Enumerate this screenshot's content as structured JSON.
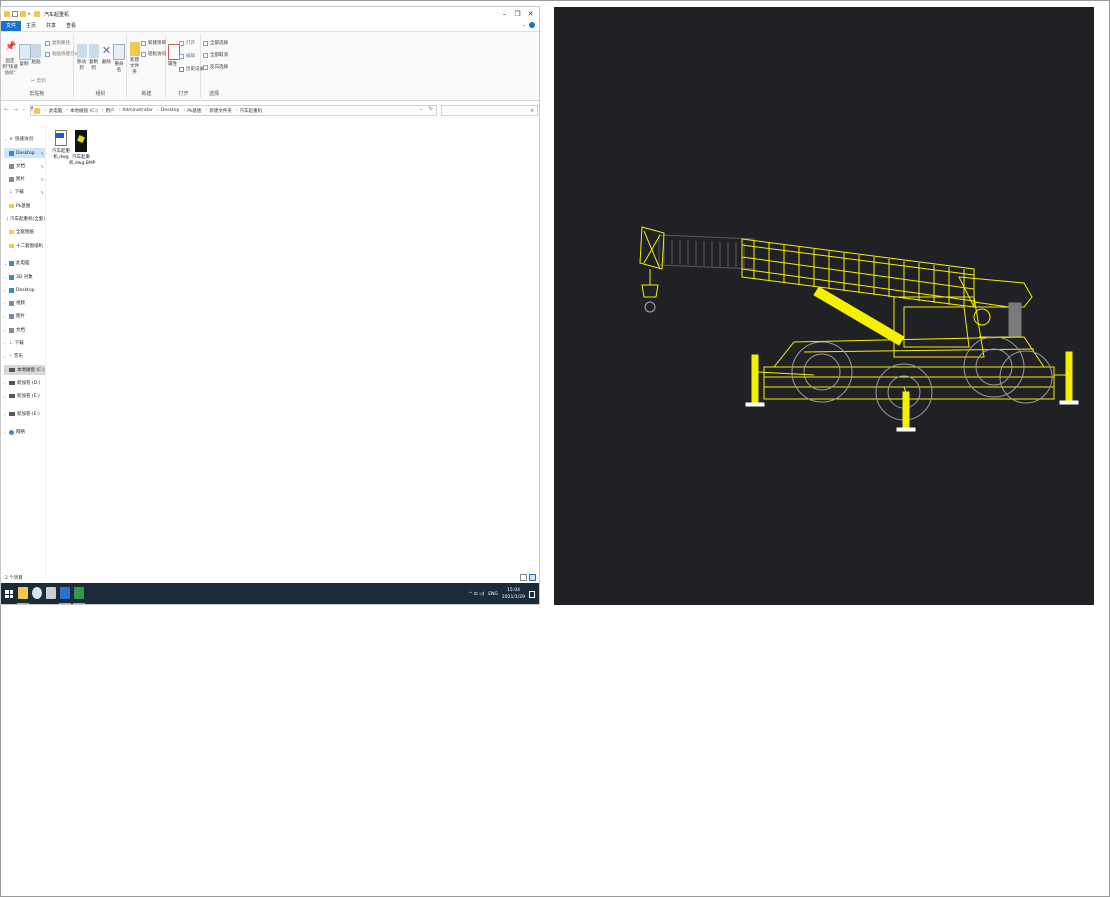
{
  "explorer": {
    "title": "汽车起重机",
    "window_controls": [
      "–",
      "❐",
      "✕"
    ],
    "ribbon_tabs": [
      "文件",
      "主页",
      "共享",
      "查看"
    ],
    "ribbon_groups": {
      "clipboard": {
        "label": "剪贴板",
        "pin_label": "固定到\"快速访问\"",
        "copy_label": "复制",
        "paste_label": "粘贴",
        "small_items": [
          "剪切",
          "复制路径",
          "粘贴快捷方式"
        ]
      },
      "organize": {
        "label": "组织",
        "move_label": "移动到",
        "copyto_label": "复制到",
        "delete_label": "删除",
        "rename_label": "重命名"
      },
      "new": {
        "label": "新建",
        "newfolder_label": "新建文件夹",
        "small_items": [
          "新建项目",
          "轻松访问"
        ]
      },
      "open": {
        "label": "打开",
        "properties_label": "属性",
        "small_items": [
          "打开",
          "编辑",
          "历史记录"
        ]
      },
      "select": {
        "label": "选择",
        "small_items": [
          "全部选择",
          "全部取消",
          "反向选择"
        ]
      }
    },
    "breadcrumb": [
      "此电脑",
      "本地磁盘 (C:)",
      "用户",
      "Administrator",
      "Desktop",
      "Pk基图",
      "新建文件夹",
      "汽车起重机"
    ],
    "search_placeholder": "",
    "nav": {
      "quick_access": "快速访问",
      "quick_items": [
        "Desktop",
        "文档",
        "图片",
        "下载",
        "Pk基图",
        "汽车起重机(全套)",
        "全套图纸",
        "十二套图纸机"
      ],
      "this_pc": "此电脑",
      "pc_items": [
        "3D 对象",
        "Desktop",
        "视频",
        "图片",
        "文档",
        "下载",
        "音乐",
        "本地磁盘 (C:)",
        "新加卷 (D:)",
        "新加卷 (E:)"
      ],
      "network_drive": "新加卷 (E:)",
      "network": "网络"
    },
    "files": [
      {
        "name": "汽车起重机.dwg",
        "type": "dwg"
      },
      {
        "name": "汽车起重机.dwg.BMP",
        "type": "bmp"
      }
    ],
    "status_count": "2 个项目",
    "taskbar": {
      "time": "15:04",
      "date": "2021/1/29",
      "lang": "ENG",
      "tray_icons": "^ ⊡ ◁)"
    }
  },
  "colors": {
    "accent": "#1a73c9",
    "taskbar": "#1c2b3a",
    "preview_bg": "#202124",
    "wireframe": "#f5ef00"
  }
}
